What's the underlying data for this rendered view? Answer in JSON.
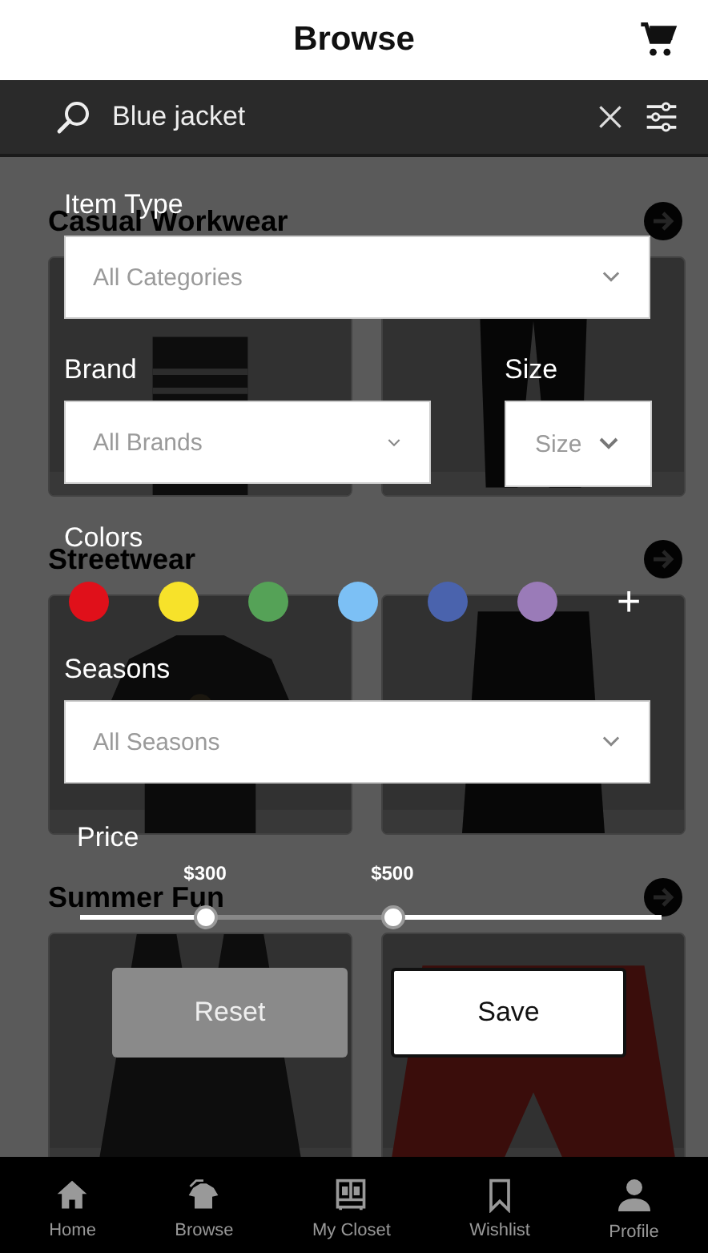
{
  "header": {
    "title": "Browse"
  },
  "search": {
    "value": "Blue jacket"
  },
  "sections": [
    {
      "title": "Casual Workwear"
    },
    {
      "title": "Streetwear"
    },
    {
      "title": "Summer Fun"
    }
  ],
  "filters": {
    "item_type": {
      "label": "Item Type",
      "value": "All Categories"
    },
    "brand": {
      "label": "Brand",
      "value": "All Brands"
    },
    "size": {
      "label": "Size",
      "value": "Size"
    },
    "colors": {
      "label": "Colors",
      "swatches": [
        {
          "color": "#e0101a"
        },
        {
          "color": "#f7e22a"
        },
        {
          "color": "#55a257"
        },
        {
          "color": "#7cc0f5"
        },
        {
          "color": "#4a63ad"
        },
        {
          "color": "#9a7bb8"
        }
      ],
      "add": "+"
    },
    "seasons": {
      "label": "Seasons",
      "value": "All Seasons"
    },
    "price": {
      "label": "Price",
      "handles": [
        {
          "label": "$300",
          "level": 0.215
        },
        {
          "label": "$500",
          "level": 0.537
        }
      ]
    },
    "buttons": {
      "reset": "Reset",
      "save": "Save"
    }
  },
  "nav": [
    {
      "label": "Home"
    },
    {
      "label": "Browse"
    },
    {
      "label": "My Closet"
    },
    {
      "label": "Wishlist"
    },
    {
      "label": "Profile"
    }
  ]
}
